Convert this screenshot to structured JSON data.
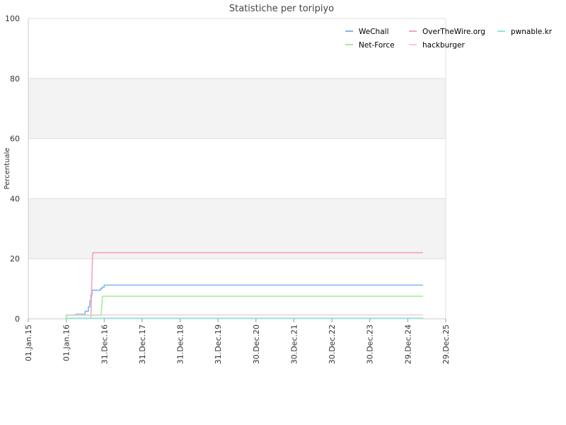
{
  "chart_data": {
    "type": "line",
    "title": "Statistiche per toripiyo",
    "xlabel": "",
    "ylabel": "Percentuale",
    "ylim": [
      0,
      100
    ],
    "yticks": [
      0,
      20,
      40,
      60,
      80,
      100
    ],
    "xlim": [
      "2015-01-01",
      "2025-12-29"
    ],
    "xtick_values": [
      "2015-01-01",
      "2016-01-01",
      "2016-12-31",
      "2017-12-31",
      "2018-12-31",
      "2019-12-31",
      "2020-12-30",
      "2021-12-30",
      "2022-12-30",
      "2023-12-30",
      "2024-12-29",
      "2025-12-29"
    ],
    "xtick_labels": [
      "01.Jan.15",
      "01.Jan.16",
      "31.Dec.16",
      "31.Dec.17",
      "31.Dec.18",
      "31.Dec.19",
      "30.Dec.20",
      "30.Dec.21",
      "30.Dec.22",
      "30.Dec.23",
      "29.Dec.24",
      "29.Dec.25"
    ],
    "grid": true,
    "legend_position": "top-right",
    "series": [
      {
        "name": "WeChall",
        "color": "#7eb5ee",
        "points": [
          [
            "2016-01-01",
            0
          ],
          [
            "2016-01-01",
            1.2
          ],
          [
            "2016-04-01",
            1.2
          ],
          [
            "2016-04-01",
            1.5
          ],
          [
            "2016-07-01",
            1.5
          ],
          [
            "2016-07-01",
            2.5
          ],
          [
            "2016-08-01",
            2.5
          ],
          [
            "2016-08-01",
            4
          ],
          [
            "2016-08-15",
            4
          ],
          [
            "2016-08-15",
            6
          ],
          [
            "2016-08-25",
            6
          ],
          [
            "2016-08-25",
            8
          ],
          [
            "2016-09-05",
            8
          ],
          [
            "2016-09-05",
            9.5
          ],
          [
            "2016-11-25",
            9.5
          ],
          [
            "2016-11-25",
            10
          ],
          [
            "2016-12-10",
            10
          ],
          [
            "2016-12-10",
            10.5
          ],
          [
            "2016-12-31",
            10.5
          ],
          [
            "2016-12-31",
            11.2
          ],
          [
            "2025-05-25",
            11.2
          ]
        ]
      },
      {
        "name": "OverTheWire.org",
        "color": "#f4a3c0",
        "points": [
          [
            "2016-08-25",
            0
          ],
          [
            "2016-09-01",
            10
          ],
          [
            "2016-09-05",
            15
          ],
          [
            "2016-09-10",
            21
          ],
          [
            "2016-09-15",
            22
          ],
          [
            "2025-05-25",
            22
          ]
        ]
      },
      {
        "name": "pwnable.kr",
        "color": "#8ae8e0",
        "points": [
          [
            "2016-01-01",
            0.2
          ],
          [
            "2025-05-25",
            0.2
          ]
        ]
      },
      {
        "name": "Net-Force",
        "color": "#a6ee9b",
        "points": [
          [
            "2016-01-01",
            0
          ],
          [
            "2016-01-01",
            1.2
          ],
          [
            "2016-11-30",
            1.2
          ],
          [
            "2016-12-15",
            7.5
          ],
          [
            "2025-05-25",
            7.5
          ]
        ]
      },
      {
        "name": "hackburger",
        "color": "#f6c9d3",
        "points": [
          [
            "2016-01-01",
            1.3
          ],
          [
            "2025-05-25",
            1.3
          ]
        ]
      }
    ]
  },
  "legend": [
    {
      "name": "WeChall",
      "color": "#7eb5ee"
    },
    {
      "name": "OverTheWire.org",
      "color": "#f4a3c0"
    },
    {
      "name": "pwnable.kr",
      "color": "#8ae8e0"
    },
    {
      "name": "Net-Force",
      "color": "#a6ee9b"
    },
    {
      "name": "hackburger",
      "color": "#f6c9d3"
    }
  ]
}
